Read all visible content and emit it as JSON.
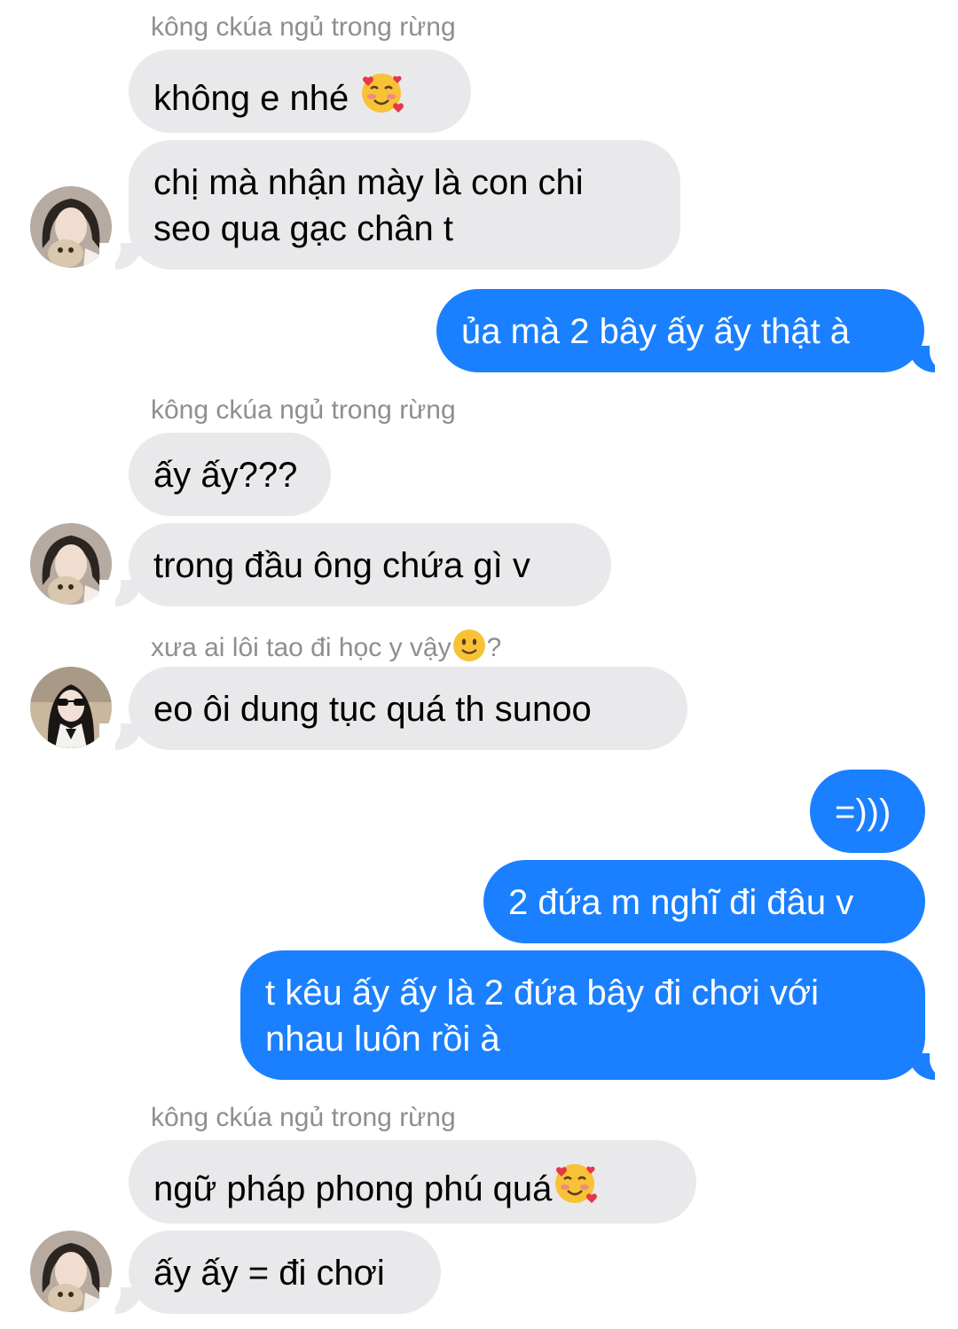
{
  "chat": {
    "messages": [
      {
        "sender_label": "kông ckúa ngủ trong rừng",
        "text": "không e nhé",
        "emoji": "smiling-face-with-hearts-icon"
      },
      {
        "line1": "chị mà nhận mày là con chi",
        "line2": "seo qua gạc chân t"
      },
      {
        "text": "ủa mà 2 bây ấy ấy thật à"
      },
      {
        "sender_label": "kông ckúa ngủ trong rừng",
        "text": "ấy ấy???"
      },
      {
        "text": "trong đầu ông chứa gì v"
      },
      {
        "sender_label": "xưa ai lôi tao đi học y vậy",
        "sender_label_suffix": "?",
        "sender_emoji": "slightly-smiling-face-icon",
        "text": "eo ôi dung tục quá th sunoo"
      },
      {
        "text": "=)))"
      },
      {
        "text": "2 đứa m nghĩ đi đâu v"
      },
      {
        "line1": "t kêu ấy ấy là 2 đứa bây đi chơi với",
        "line2": "nhau luôn rồi à"
      },
      {
        "sender_label": "kông ckúa ngủ trong rừng",
        "text": "ngữ pháp phong phú quá",
        "emoji": "smiling-face-with-hearts-icon"
      },
      {
        "text": "ấy ấy = đi chơi"
      }
    ]
  },
  "colors": {
    "outgoing_bubble": "#1a80ff",
    "incoming_bubble": "#e9e9eb",
    "sender_label": "#8e8e93"
  }
}
